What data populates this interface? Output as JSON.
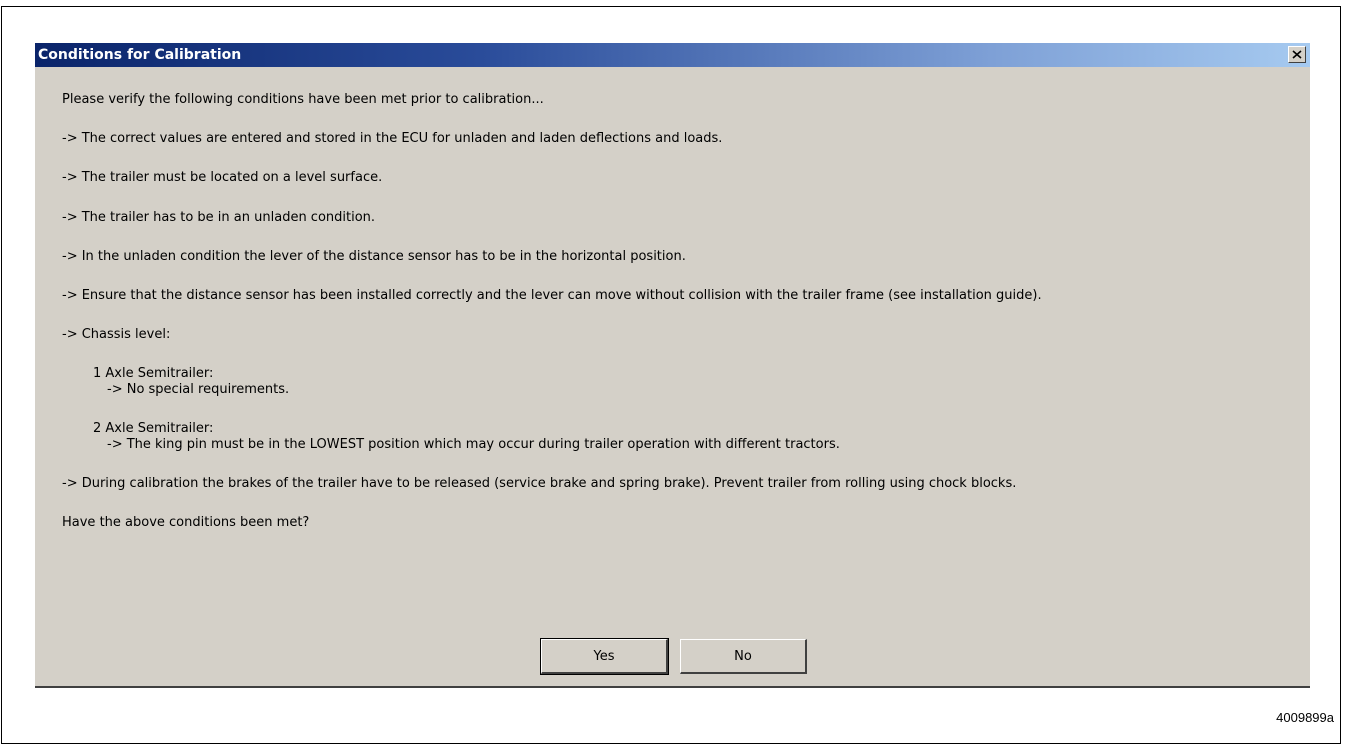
{
  "dialog": {
    "title": "Conditions for Calibration",
    "lines": [
      "Please verify the following conditions have been met prior to calibration...",
      "-> The correct values are entered and stored in the ECU for unladen and laden deflections and loads.",
      "-> The trailer must be located on a level surface.",
      "-> The trailer has to be in an unladen condition.",
      "-> In the unladen condition the lever of the distance sensor has to be in the horizontal position.",
      "-> Ensure that the distance sensor has been installed correctly and the lever can move without collision with the trailer frame (see installation guide).",
      "-> Chassis level:",
      "1 Axle Semitrailer:",
      "-> No special requirements.",
      "2 Axle Semitrailer:",
      "-> The king pin must be in the LOWEST position which may occur during trailer operation with different tractors.",
      "-> During calibration the brakes of the trailer have to be released (service brake and spring brake).  Prevent trailer from rolling using chock blocks.",
      "Have the above conditions been met?"
    ],
    "buttons": {
      "yes": "Yes",
      "no": "No"
    },
    "close_icon": "close-icon"
  },
  "figure_id": "4009899a",
  "colors": {
    "title_start": "#0a246a",
    "title_end": "#a6caf0",
    "dialog_bg": "#d4d0c8"
  }
}
